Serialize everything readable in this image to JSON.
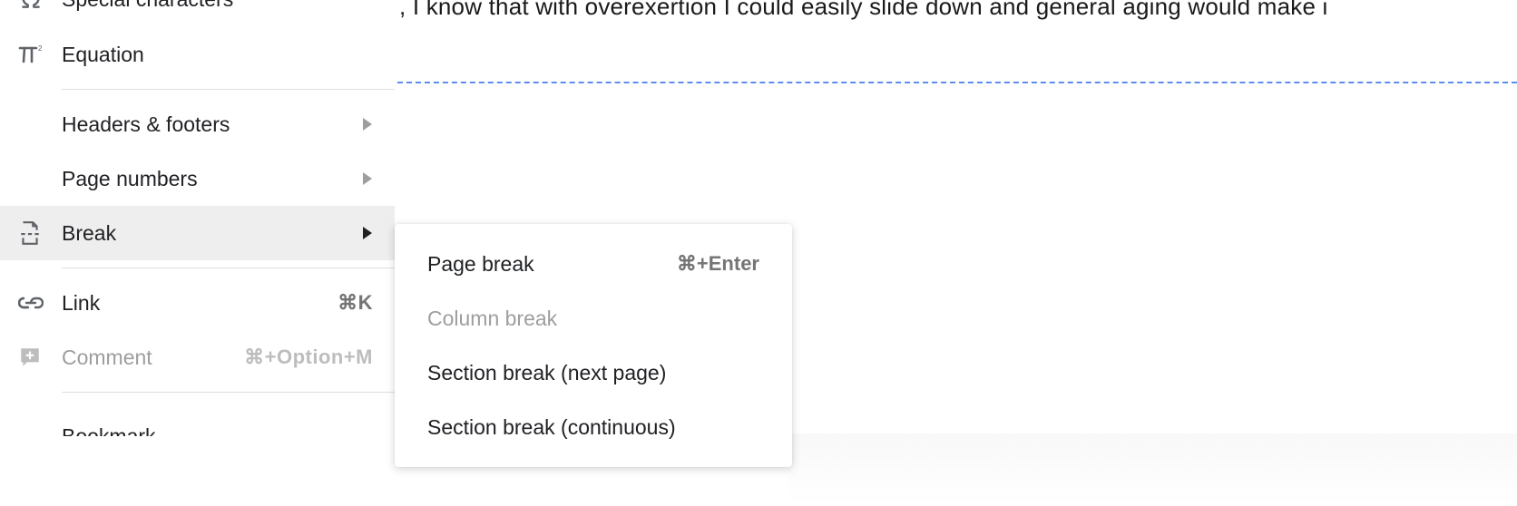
{
  "document": {
    "visible_text": ", I know that with overexertion I could easily slide down and general aging would make i"
  },
  "menu": {
    "special_chars": {
      "label": "Special characters"
    },
    "equation": {
      "label": "Equation"
    },
    "headers_footers": {
      "label": "Headers & footers"
    },
    "page_numbers": {
      "label": "Page numbers"
    },
    "break": {
      "label": "Break"
    },
    "link": {
      "label": "Link",
      "shortcut": "⌘K"
    },
    "comment": {
      "label": "Comment",
      "shortcut": "⌘+Option+M"
    },
    "bookmark": {
      "label": "Bookmark"
    }
  },
  "submenu": {
    "page_break": {
      "label": "Page break",
      "shortcut": "⌘+Enter"
    },
    "column_break": {
      "label": "Column break"
    },
    "section_next": {
      "label": "Section break (next page)"
    },
    "section_cont": {
      "label": "Section break (continuous)"
    }
  }
}
